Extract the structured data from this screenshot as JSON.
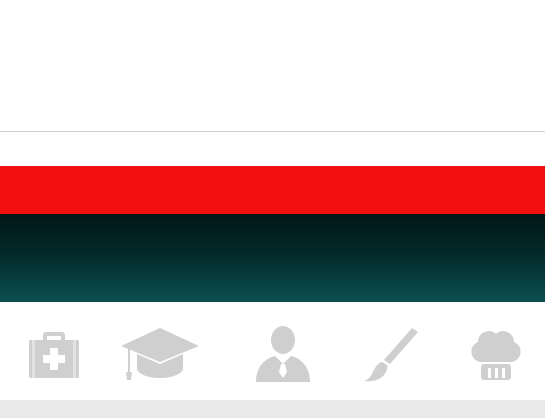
{
  "colors": {
    "accent_red": "#f20f0f",
    "dark_teal_top": "#021717",
    "dark_teal_bottom": "#0a4f50",
    "icon_gray": "#cfcfcf",
    "divider": "#cfcfcf",
    "bottom_strip": "#e9e9e9"
  },
  "category_icons": [
    {
      "icon": "first-aid-kit-icon"
    },
    {
      "icon": "graduation-cap-icon"
    },
    {
      "icon": "person-icon"
    },
    {
      "icon": "paint-brush-icon"
    },
    {
      "icon": "chef-hat-icon"
    }
  ]
}
